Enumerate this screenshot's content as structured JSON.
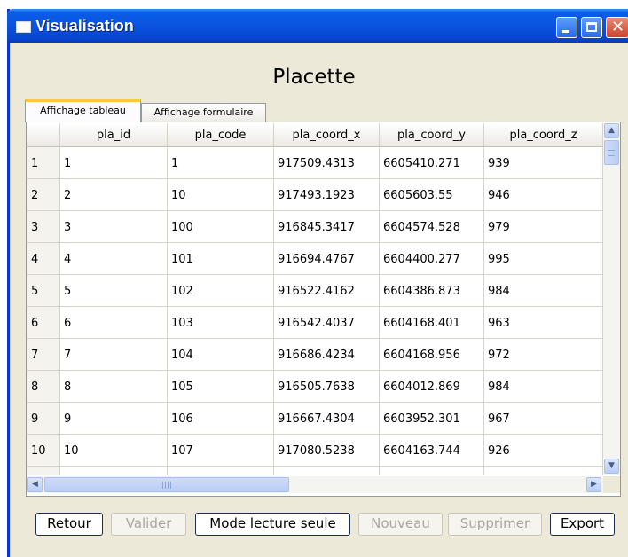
{
  "window": {
    "title": "Visualisation",
    "controls": {
      "minimize": "_",
      "maximize": "□",
      "close": "✕"
    }
  },
  "heading": "Placette",
  "tabs": [
    {
      "label": "Affichage tableau",
      "active": true
    },
    {
      "label": "Affichage formulaire",
      "active": false
    }
  ],
  "table": {
    "columns": [
      "pla_id",
      "pla_code",
      "pla_coord_x",
      "pla_coord_y",
      "pla_coord_z"
    ],
    "rows": [
      {
        "num": "1",
        "cells": [
          "1",
          "1",
          "917509.4313",
          "6605410.271",
          "939"
        ]
      },
      {
        "num": "2",
        "cells": [
          "2",
          "10",
          "917493.1923",
          "6605603.55",
          "946"
        ]
      },
      {
        "num": "3",
        "cells": [
          "3",
          "100",
          "916845.3417",
          "6604574.528",
          "979"
        ]
      },
      {
        "num": "4",
        "cells": [
          "4",
          "101",
          "916694.4767",
          "6604400.277",
          "995"
        ]
      },
      {
        "num": "5",
        "cells": [
          "5",
          "102",
          "916522.4162",
          "6604386.873",
          "984"
        ]
      },
      {
        "num": "6",
        "cells": [
          "6",
          "103",
          "916542.4037",
          "6604168.401",
          "963"
        ]
      },
      {
        "num": "7",
        "cells": [
          "7",
          "104",
          "916686.4234",
          "6604168.956",
          "972"
        ]
      },
      {
        "num": "8",
        "cells": [
          "8",
          "105",
          "916505.7638",
          "6604012.869",
          "984"
        ]
      },
      {
        "num": "9",
        "cells": [
          "9",
          "106",
          "916667.4304",
          "6603952.301",
          "967"
        ]
      },
      {
        "num": "10",
        "cells": [
          "10",
          "107",
          "917080.5238",
          "6604163.744",
          "926"
        ]
      }
    ]
  },
  "scrollbar_glyphs": {
    "up": "▲",
    "down": "▼",
    "left": "◀",
    "right": "▶"
  },
  "buttons": {
    "retour": "Retour",
    "valider": "Valider",
    "mode_lecture": "Mode lecture seule",
    "nouveau": "Nouveau",
    "supprimer": "Supprimer",
    "export": "Export"
  }
}
